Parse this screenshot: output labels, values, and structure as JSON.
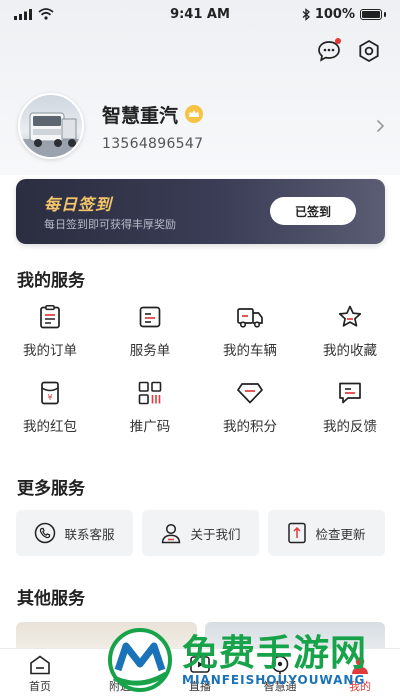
{
  "status_bar": {
    "time": "9:41 AM",
    "battery": "100%"
  },
  "header": {
    "message_icon": "message-icon",
    "settings_icon": "settings-icon"
  },
  "profile": {
    "name": "智慧重汽",
    "phone": "13564896547",
    "badge_icon": "crown-badge-icon",
    "arrow_icon": "chevron-right-icon"
  },
  "sign_card": {
    "title": "每日签到",
    "subtitle": "每日签到即可获得丰厚奖励",
    "button": "已签到"
  },
  "my_services": {
    "title": "我的服务",
    "items": [
      {
        "label": "我的订单",
        "icon": "order-icon"
      },
      {
        "label": "服务单",
        "icon": "service-order-icon"
      },
      {
        "label": "我的车辆",
        "icon": "truck-icon"
      },
      {
        "label": "我的收藏",
        "icon": "star-icon"
      },
      {
        "label": "我的红包",
        "icon": "red-envelope-icon"
      },
      {
        "label": "推广码",
        "icon": "qr-code-icon"
      },
      {
        "label": "我的积分",
        "icon": "diamond-icon"
      },
      {
        "label": "我的反馈",
        "icon": "feedback-icon"
      }
    ]
  },
  "more_services": {
    "title": "更多服务",
    "items": [
      {
        "label": "联系客服",
        "icon": "phone-icon"
      },
      {
        "label": "关于我们",
        "icon": "user-icon"
      },
      {
        "label": "检查更新",
        "icon": "update-icon"
      }
    ]
  },
  "other_services": {
    "title": "其他服务"
  },
  "tab_bar": {
    "items": [
      {
        "label": "首页",
        "icon": "home-icon"
      },
      {
        "label": "附近",
        "icon": "location-icon"
      },
      {
        "label": "直播",
        "icon": "live-icon"
      },
      {
        "label": "智慧通",
        "icon": "smart-icon"
      },
      {
        "label": "我的",
        "icon": "profile-icon"
      }
    ]
  },
  "watermark": {
    "text": "免费手游网",
    "sub": "MIANFEISHOUYOUWANG"
  },
  "colors": {
    "accent": "#e23b3b",
    "gold": "#f4c56a",
    "card_dark": "#2b2d40",
    "watermark_green": "#17a34a"
  }
}
